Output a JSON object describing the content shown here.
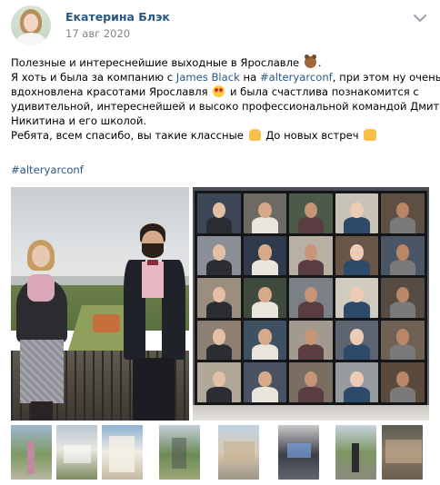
{
  "post": {
    "author": "Екатерина Блэк",
    "date": "17 авг 2020",
    "text": {
      "l1_a": "Полезные и интереснейшие выходные в Ярославле ",
      "l1_b": ".",
      "l2_a": "Я хоть и была за компанию с ",
      "l2_mention": "James Black",
      "l2_b": " на ",
      "l2_hashtag": "#alteryarconf",
      "l2_c": ", при этом ну очень",
      "l3_a": "вдохновлена красотами Ярославля ",
      "l3_b": " и была счастлива познакомится с",
      "l4": "удивительной, интереснейшей и высоко профессиональной командой Дмитрия",
      "l5": "Никитина и его школой.",
      "l6_a": "Ребята, всем спасибо, вы такие классные ",
      "l6_b": " До новых встреч "
    },
    "hashtag": "#alteryarconf",
    "emoji_icons": [
      "bear-emoji",
      "heart-eyes-emoji",
      "folded-hands-emoji",
      "raising-hands-emoji"
    ]
  },
  "colors": {
    "link": "#2a5885",
    "meta": "#828282"
  }
}
